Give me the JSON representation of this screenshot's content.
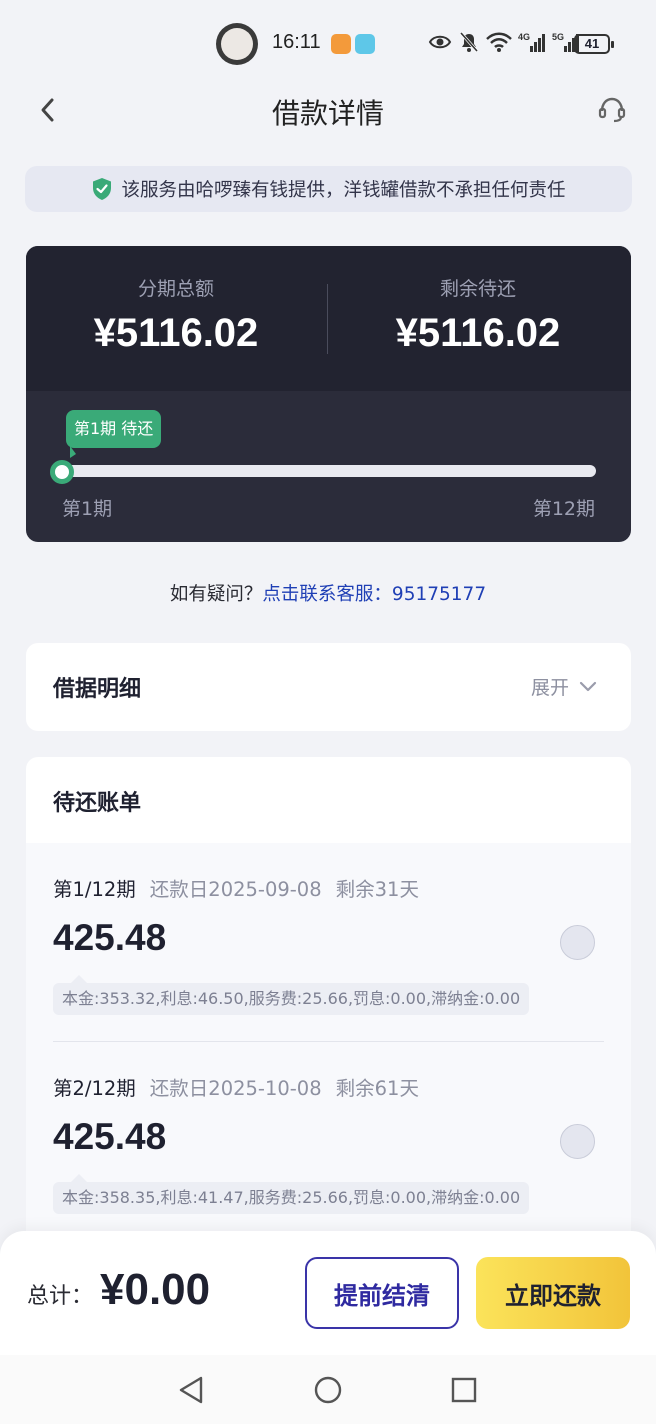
{
  "status_bar": {
    "time": "16:11",
    "battery": "41",
    "network1": "4G",
    "network2": "5G"
  },
  "header": {
    "title": "借款详情"
  },
  "notice": {
    "text": "该服务由哈啰臻有钱提供，洋钱罐借款不承担任何责任"
  },
  "summary": {
    "total_label": "分期总额",
    "total_value": "¥5116.02",
    "remaining_label": "剩余待还",
    "remaining_value": "¥5116.02",
    "progress_tag": "第1期 待还",
    "progress_start": "第1期",
    "progress_end": "第12期",
    "progress_fraction": 0
  },
  "help": {
    "prefix": "如有疑问？",
    "link": "点击联系客服：95175177"
  },
  "loan_details": {
    "title": "借据明细",
    "expand_label": "展开"
  },
  "bills": {
    "title": "待还账单",
    "items": [
      {
        "period": "第1/12期",
        "due": "还款日2025-09-08",
        "remaining": "剩余31天",
        "amount": "425.48",
        "breakdown": "本金:353.32,利息:46.50,服务费:25.66,罚息:0.00,滞纳金:0.00"
      },
      {
        "period": "第2/12期",
        "due": "还款日2025-10-08",
        "remaining": "剩余61天",
        "amount": "425.48",
        "breakdown": "本金:358.35,利息:41.47,服务费:25.66,罚息:0.00,滞纳金:0.00"
      }
    ]
  },
  "footer": {
    "total_label": "总计：",
    "total_value": "¥0.00",
    "early_button": "提前结清",
    "repay_button": "立即还款"
  },
  "colors": {
    "accent_green": "#3aaa78",
    "dark_card": "#222330",
    "link_blue": "#1f3fb5",
    "button_yellow": "#f2c43a",
    "button_border": "#3a34a8"
  },
  "icons": {
    "back": "chevron-left-icon",
    "service": "headset-icon",
    "shield": "shield-check-icon",
    "expand": "chevron-down-icon"
  }
}
